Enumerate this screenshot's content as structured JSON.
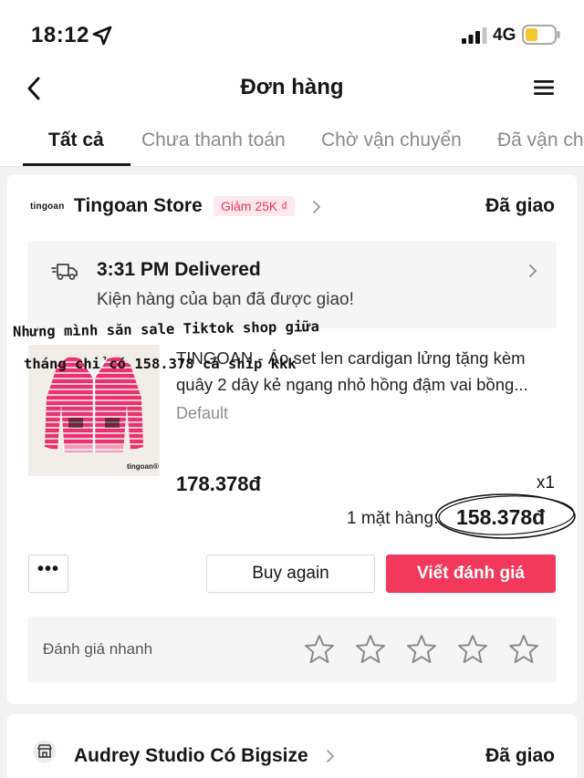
{
  "status_bar": {
    "time": "18:12",
    "network": "4G",
    "icons": [
      "location-arrow-icon",
      "signal-icon",
      "battery-icon"
    ]
  },
  "nav": {
    "title": "Đơn hàng",
    "icons": [
      "back-icon",
      "menu-icon"
    ]
  },
  "tabs": [
    {
      "label": "Tất cả",
      "active": true
    },
    {
      "label": "Chưa thanh toán",
      "active": false
    },
    {
      "label": "Chờ vận chuyển",
      "active": false
    },
    {
      "label": "Đã vận chuyển",
      "active": false
    }
  ],
  "order1": {
    "store_logo": "tingoan",
    "store_name": "Tingoan Store",
    "voucher": "Giảm 25K ₫",
    "status": "Đã giao",
    "delivery": {
      "time": "3:31 PM Delivered",
      "message": "Kiện hàng của bạn đã được giao!"
    },
    "product": {
      "title": "TINGOAN - Áo set len cardigan lửng tặng kèm quây 2 dây kẻ ngang nhỏ hồng đậm vai bồng...",
      "variant": "Default",
      "price": "178.378đ",
      "qty": "x1",
      "image_brand": "tingoan®"
    },
    "total_count": "1 mặt hàng:",
    "total_price": "158.378đ",
    "buttons": {
      "more": "•••",
      "buy_again": "Buy again",
      "review": "Viết đánh giá"
    },
    "quick_rate": {
      "label": "Đánh giá nhanh",
      "stars": 5
    }
  },
  "handwriting": {
    "line1": "Nhưng mình săn sale Tiktok shop giữa",
    "line2": "tháng chỉ có 158.378 cả ship kkk"
  },
  "order2": {
    "store_name": "Audrey Studio Có Bigsize",
    "status": "Đã giao"
  },
  "colors": {
    "accent": "#f2385c",
    "voucher_bg": "#ffe9ee",
    "voucher_text": "#e8335a",
    "product_pink": "#e8336f"
  }
}
